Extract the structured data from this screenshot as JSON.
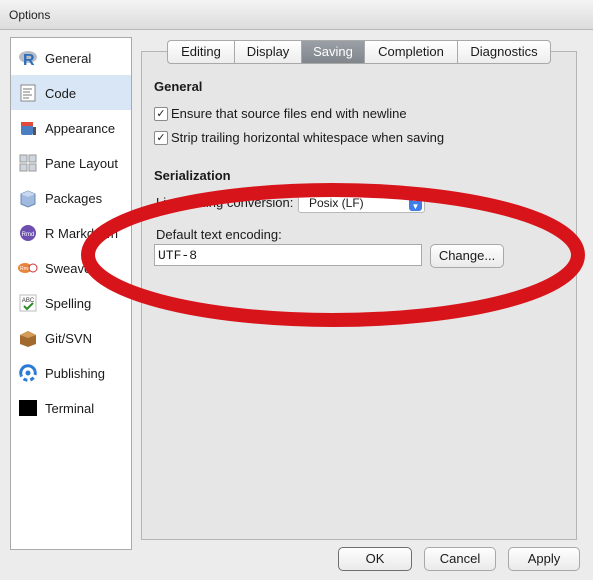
{
  "window": {
    "title": "Options"
  },
  "sidebar": {
    "items": [
      {
        "label": "General",
        "icon": "r-logo-icon"
      },
      {
        "label": "Code",
        "icon": "code-document-icon",
        "selected": true
      },
      {
        "label": "Appearance",
        "icon": "paint-bucket-icon"
      },
      {
        "label": "Pane Layout",
        "icon": "pane-layout-icon"
      },
      {
        "label": "Packages",
        "icon": "package-box-icon"
      },
      {
        "label": "R Markdown",
        "icon": "rmd-icon",
        "badge": "Rmd"
      },
      {
        "label": "Sweave",
        "icon": "sweave-icon",
        "badge": "Rnw"
      },
      {
        "label": "Spelling",
        "icon": "spelling-check-icon",
        "badge": "ABC"
      },
      {
        "label": "Git/SVN",
        "icon": "git-box-icon"
      },
      {
        "label": "Publishing",
        "icon": "publishing-icon"
      },
      {
        "label": "Terminal",
        "icon": "terminal-icon"
      }
    ]
  },
  "tabs": [
    {
      "label": "Editing"
    },
    {
      "label": "Display"
    },
    {
      "label": "Saving",
      "active": true
    },
    {
      "label": "Completion"
    },
    {
      "label": "Diagnostics"
    }
  ],
  "general": {
    "heading": "General",
    "ensure_newline": {
      "label": "Ensure that source files end with newline",
      "checked": true
    },
    "strip_whitespace": {
      "label": "Strip trailing horizontal whitespace when saving",
      "checked": true
    }
  },
  "serialization": {
    "heading": "Serialization",
    "line_ending_label": "Line ending conversion:",
    "line_ending_value": "Posix (LF)",
    "encoding_label": "Default text encoding:",
    "encoding_value": "UTF-8",
    "change_button": "Change..."
  },
  "footer": {
    "ok": "OK",
    "cancel": "Cancel",
    "apply": "Apply"
  },
  "annotation": {
    "color": "#d8141b"
  },
  "checkmark": "✓"
}
